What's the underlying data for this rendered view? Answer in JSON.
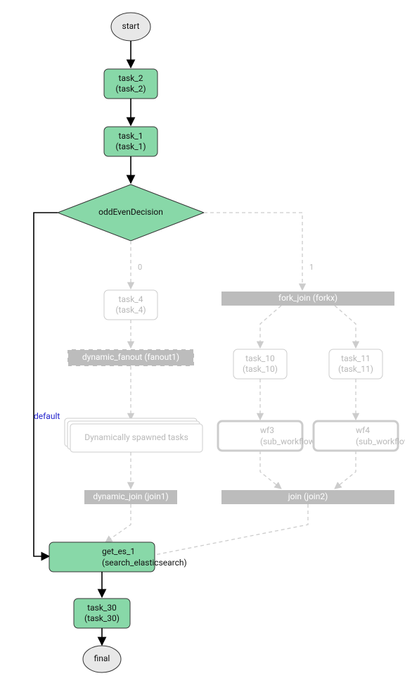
{
  "chart_data": {
    "type": "flowchart",
    "nodes": [
      {
        "id": "start",
        "type": "ellipse",
        "label": "start"
      },
      {
        "id": "task_2",
        "type": "task",
        "label_line1": "task_2",
        "label_line2": "(task_2)"
      },
      {
        "id": "task_1",
        "type": "task",
        "label_line1": "task_1",
        "label_line2": "(task_1)"
      },
      {
        "id": "decision",
        "type": "diamond",
        "label": "oddEvenDecision"
      },
      {
        "id": "task_4",
        "type": "task_faded",
        "label_line1": "task_4",
        "label_line2": "(task_4)"
      },
      {
        "id": "dynamic_fanout",
        "type": "bar_dashed",
        "label": "dynamic_fanout (fanout1)"
      },
      {
        "id": "spawned",
        "type": "stacked",
        "label": "Dynamically spawned tasks"
      },
      {
        "id": "dynamic_join",
        "type": "bar",
        "label": "dynamic_join (join1)"
      },
      {
        "id": "fork_join",
        "type": "bar",
        "label": "fork_join (forkx)"
      },
      {
        "id": "task_10",
        "type": "task_faded",
        "label_line1": "task_10",
        "label_line2": "(task_10)"
      },
      {
        "id": "task_11",
        "type": "task_faded",
        "label_line1": "task_11",
        "label_line2": "(task_11)"
      },
      {
        "id": "wf3",
        "type": "subwf",
        "label_line1": "wf3",
        "label_line2": "(sub_workflow_x)"
      },
      {
        "id": "wf4",
        "type": "subwf",
        "label_line1": "wf4",
        "label_line2": "(sub_workflow_x)"
      },
      {
        "id": "join2",
        "type": "bar",
        "label": "join (join2)"
      },
      {
        "id": "get_es_1",
        "type": "task",
        "label_line1": "get_es_1",
        "label_line2": "(search_elasticsearch)"
      },
      {
        "id": "task_30",
        "type": "task",
        "label_line1": "task_30",
        "label_line2": "(task_30)"
      },
      {
        "id": "final",
        "type": "ellipse",
        "label": "final"
      }
    ],
    "edges": [
      {
        "from": "start",
        "to": "task_2",
        "style": "solid"
      },
      {
        "from": "task_2",
        "to": "task_1",
        "style": "solid"
      },
      {
        "from": "task_1",
        "to": "decision",
        "style": "solid"
      },
      {
        "from": "decision",
        "to": "get_es_1",
        "style": "solid",
        "label": "default"
      },
      {
        "from": "decision",
        "to": "task_4",
        "style": "dashed",
        "label": "0"
      },
      {
        "from": "decision",
        "to": "fork_join",
        "style": "dashed",
        "label": "1"
      },
      {
        "from": "task_4",
        "to": "dynamic_fanout",
        "style": "dashed"
      },
      {
        "from": "dynamic_fanout",
        "to": "spawned",
        "style": "dashed"
      },
      {
        "from": "spawned",
        "to": "dynamic_join",
        "style": "dashed"
      },
      {
        "from": "dynamic_join",
        "to": "get_es_1",
        "style": "dashed"
      },
      {
        "from": "fork_join",
        "to": "task_10",
        "style": "dashed"
      },
      {
        "from": "fork_join",
        "to": "task_11",
        "style": "dashed"
      },
      {
        "from": "task_10",
        "to": "wf3",
        "style": "dashed"
      },
      {
        "from": "task_11",
        "to": "wf4",
        "style": "dashed"
      },
      {
        "from": "wf3",
        "to": "join2",
        "style": "dashed"
      },
      {
        "from": "wf4",
        "to": "join2",
        "style": "dashed"
      },
      {
        "from": "join2",
        "to": "get_es_1",
        "style": "dashed"
      },
      {
        "from": "get_es_1",
        "to": "task_30",
        "style": "solid"
      },
      {
        "from": "task_30",
        "to": "final",
        "style": "solid"
      }
    ]
  },
  "labels": {
    "start": "start",
    "task_2_l1": "task_2",
    "task_2_l2": "(task_2)",
    "task_1_l1": "task_1",
    "task_1_l2": "(task_1)",
    "decision": "oddEvenDecision",
    "branch_0": "0",
    "branch_1": "1",
    "branch_default": "default",
    "task_4_l1": "task_4",
    "task_4_l2": "(task_4)",
    "dynamic_fanout": "dynamic_fanout (fanout1)",
    "spawned": "Dynamically spawned tasks",
    "dynamic_join": "dynamic_join (join1)",
    "fork_join": "fork_join (forkx)",
    "task_10_l1": "task_10",
    "task_10_l2": "(task_10)",
    "task_11_l1": "task_11",
    "task_11_l2": "(task_11)",
    "wf3_l1": "wf3",
    "wf3_l2": "(sub_workflow_x)",
    "wf4_l1": "wf4",
    "wf4_l2": "(sub_workflow_x)",
    "join2": "join (join2)",
    "get_es_l1": "get_es_1",
    "get_es_l2": "(search_elasticsearch)",
    "task_30_l1": "task_30",
    "task_30_l2": "(task_30)",
    "final": "final"
  }
}
